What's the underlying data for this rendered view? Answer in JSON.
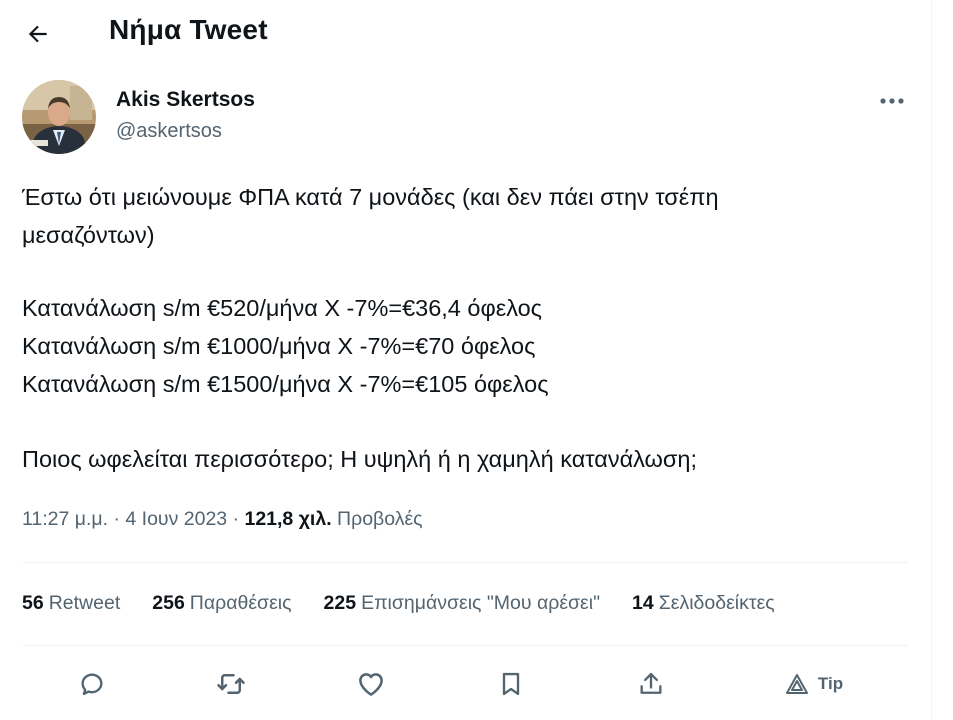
{
  "header": {
    "back_icon": "arrow-left-icon",
    "title": "Νήμα Tweet"
  },
  "tweet": {
    "author": {
      "name": "Akis Skertsos",
      "handle": "@askertsos",
      "avatar_icon": "profile-photo"
    },
    "more_icon": "more-horizontal-icon",
    "text_lines": [
      "Έστω ότι μειώνουμε ΦΠΑ κατά 7 μονάδες (και δεν πάει στην τσέπη",
      "μεσαζόντων)",
      "Κατανάλωση s/m €520/μήνα Χ -7%=€36,4 όφελος",
      "Κατανάλωση s/m €1000/μήνα Χ -7%=€70 όφελος",
      "Κατανάλωση s/m €1500/μήνα Χ -7%=€105 όφελος",
      "Ποιος ωφελείται περισσότερο; Η υψηλή ή η χαμηλή κατανάλωση;"
    ],
    "timestamp": "11:27 μ.μ. · 4 Ιουν 2023 · ",
    "views_count": "121,8 χιλ.",
    "views_label": " Προβολές"
  },
  "stats": {
    "retweets": {
      "count": "56",
      "label": "Retweet"
    },
    "quotes": {
      "count": "256",
      "label": "Παραθέσεις"
    },
    "likes": {
      "count": "225",
      "label": "Επισημάνσεις \"Μου αρέσει\""
    },
    "bookmarks": {
      "count": "14",
      "label": "Σελιδοδείκτες"
    }
  },
  "actions": {
    "reply_icon": "reply-icon",
    "retweet_icon": "retweet-icon",
    "like_icon": "heart-icon",
    "bookmark_icon": "bookmark-icon",
    "share_icon": "share-icon",
    "tip_icon": "tip-icon",
    "tip_label": "Tip"
  },
  "colors": {
    "text": "#0f1419",
    "secondary": "#536471",
    "divider": "#eff3f4"
  }
}
